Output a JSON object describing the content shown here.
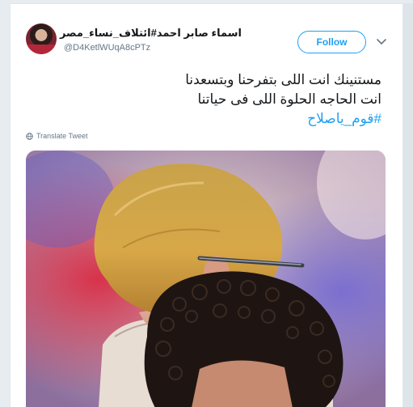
{
  "user": {
    "display_name": "اسماء صابر احمد#ائتلاف_نساء_مصر",
    "handle": "@D4KetlWUqA8cPTz"
  },
  "follow_label": "Follow",
  "tweet": {
    "lines": [
      "مستنينك انت اللى بتفرحنا وبتسعدنا",
      "انت الحاجه الحلوة اللى فى حياتنا"
    ],
    "hashtag": "#قوم_ياصلاح"
  },
  "translate_label": "Translate Tweet",
  "colors": {
    "accent": "#1da1f2",
    "text": "#14171a",
    "muted": "#657786",
    "background": "#e6ecf0"
  },
  "icons": {
    "caret": "chevron-down-icon",
    "translate": "globe-icon"
  }
}
